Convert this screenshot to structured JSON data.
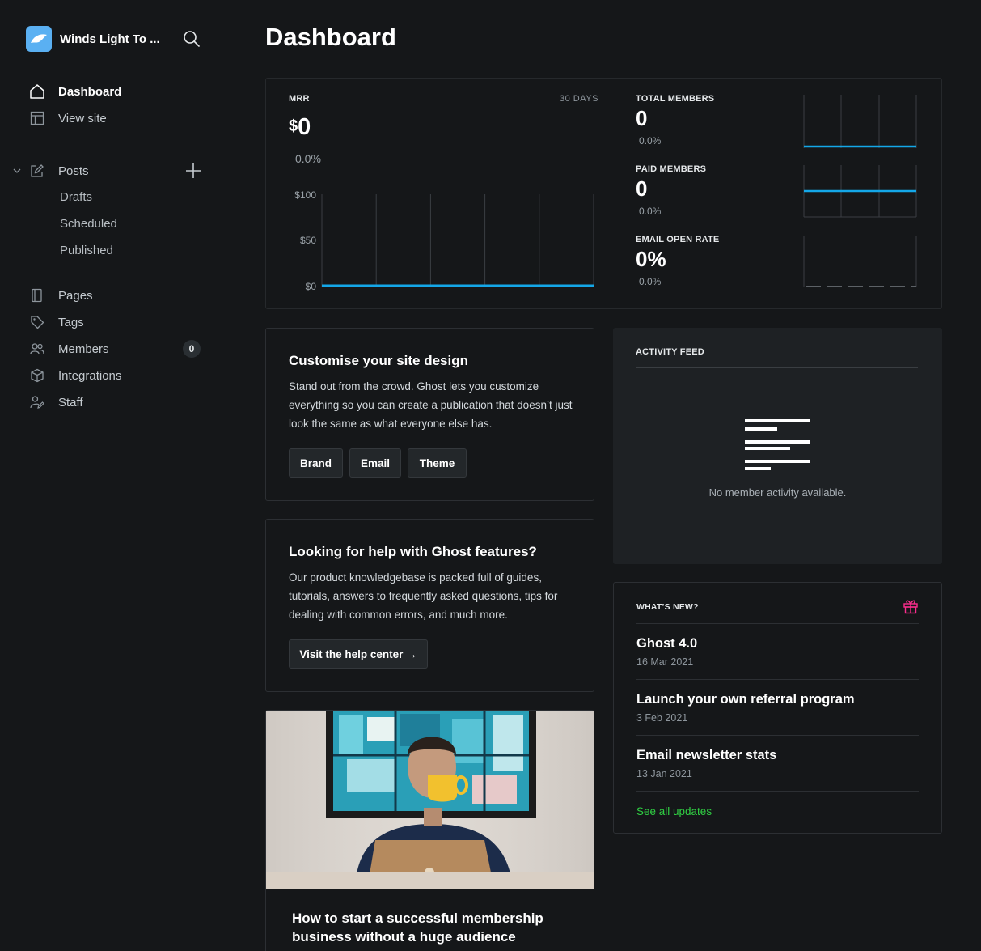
{
  "sidebar": {
    "site_name": "Winds Light To ...",
    "nav": {
      "dashboard": "Dashboard",
      "view_site": "View site",
      "posts": "Posts",
      "drafts": "Drafts",
      "scheduled": "Scheduled",
      "published": "Published",
      "pages": "Pages",
      "tags": "Tags",
      "members": "Members",
      "members_count": "0",
      "integrations": "Integrations",
      "staff": "Staff"
    }
  },
  "page": {
    "title": "Dashboard"
  },
  "mrr": {
    "label": "MRR",
    "period": "30 DAYS",
    "currency": "$",
    "value": "0",
    "change": "0.0%",
    "axis": [
      "$100",
      "$50",
      "$0"
    ]
  },
  "chart_data": [
    {
      "type": "line",
      "title": "MRR",
      "x": [
        1,
        2,
        3,
        4,
        5,
        6,
        7,
        8,
        9,
        10,
        11,
        12,
        13,
        14,
        15,
        16,
        17,
        18,
        19,
        20,
        21,
        22,
        23,
        24,
        25,
        26,
        27,
        28,
        29,
        30
      ],
      "series": [
        {
          "values": [
            0,
            0,
            0,
            0,
            0,
            0,
            0,
            0,
            0,
            0,
            0,
            0,
            0,
            0,
            0,
            0,
            0,
            0,
            0,
            0,
            0,
            0,
            0,
            0,
            0,
            0,
            0,
            0,
            0,
            0
          ]
        }
      ],
      "ylim": [
        0,
        100
      ],
      "yticks": [
        "$0",
        "$50",
        "$100"
      ],
      "grid": "vertical"
    }
  ],
  "stats": {
    "total_members": {
      "label": "TOTAL MEMBERS",
      "value": "0",
      "change": "0.0%"
    },
    "paid_members": {
      "label": "PAID MEMBERS",
      "value": "0",
      "change": "0.0%"
    },
    "email_open_rate": {
      "label": "EMAIL OPEN RATE",
      "value": "0%",
      "change": "0.0%"
    }
  },
  "customise": {
    "title": "Customise your site design",
    "body": "Stand out from the crowd. Ghost lets you customize everything so you can create a publication that doesn’t just look the same as what everyone else has.",
    "buttons": [
      "Brand",
      "Email",
      "Theme"
    ]
  },
  "help": {
    "title": "Looking for help with Ghost features?",
    "body": "Our product knowledgebase is packed full of guides, tutorials, answers to frequently asked questions, tips for dealing with common errors, and much more.",
    "button": "Visit the help center →"
  },
  "activity": {
    "title": "ACTIVITY FEED",
    "empty": "No member activity available."
  },
  "whats_new": {
    "title": "WHAT’S NEW?",
    "items": [
      {
        "title": "Ghost 4.0",
        "date": "16 Mar 2021"
      },
      {
        "title": "Launch your own referral program",
        "date": "3 Feb 2021"
      },
      {
        "title": "Email newsletter stats",
        "date": "13 Jan 2021"
      }
    ],
    "see_all": "See all updates"
  },
  "article": {
    "title_line1": "How to start a successful membership",
    "title_line2": "business without a huge audience"
  },
  "colors": {
    "accent_blue": "#14a7e8",
    "link_green": "#30cf43",
    "gift_pink": "#fb2d8d",
    "logo_blue": "#5ab0f2"
  }
}
